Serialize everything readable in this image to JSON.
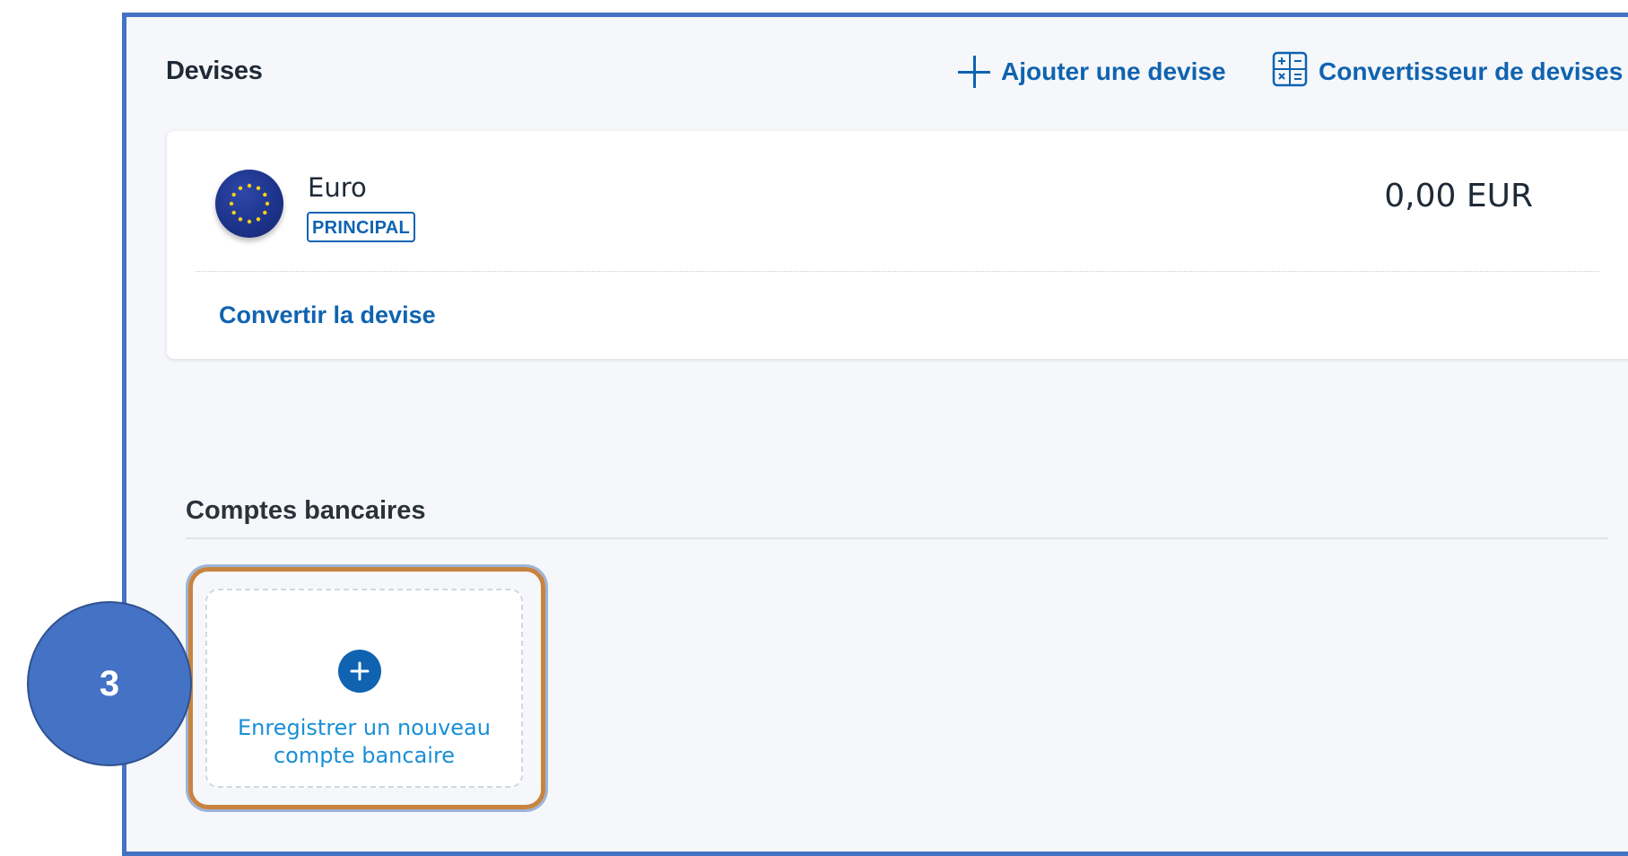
{
  "currencies_section": {
    "title": "Devises",
    "add_currency_label": "Ajouter une devise",
    "add_currency_icon": "plus-icon",
    "converter_label": "Convertisseur de devises",
    "converter_icon": "calculator-icon"
  },
  "currency_card": {
    "flag_icon": "eu-flag-icon",
    "name": "Euro",
    "badge": "PRINCIPAL",
    "balance": "0,00 EUR",
    "convert_link": "Convertir la devise"
  },
  "bank_section": {
    "title": "Comptes bancaires",
    "add_icon": "plus-circle-icon",
    "add_label_line1": "Enregistrer un nouveau",
    "add_label_line2": "compte bancaire"
  },
  "annotation": {
    "step_number": "3",
    "highlight_color": "#c8843f",
    "badge_color": "#4472c4"
  },
  "colors": {
    "accent": "#0f63b0",
    "link_light": "#1a8fd6",
    "frame_border": "#4472c4",
    "background": "#f5f7fa"
  }
}
